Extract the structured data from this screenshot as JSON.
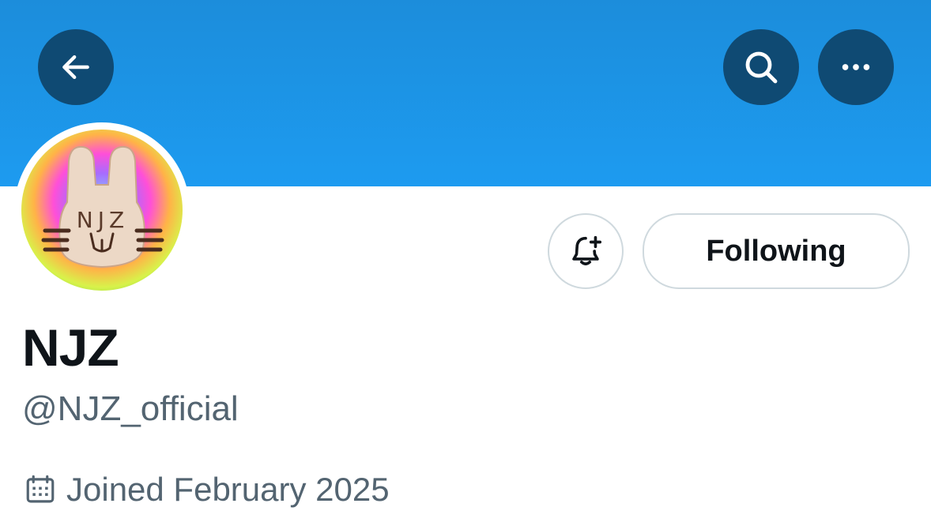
{
  "profile": {
    "display_name": "NJZ",
    "handle": "@NJZ_official",
    "joined": "Joined February 2025",
    "avatar_text": "NJZ"
  },
  "actions": {
    "following_label": "Following"
  },
  "icons": {
    "back": "arrow-left-icon",
    "search": "search-icon",
    "more": "more-horizontal-icon",
    "notify": "bell-plus-icon",
    "calendar": "calendar-icon"
  },
  "colors": {
    "banner": "#1d9bf0",
    "header_button": "#0f4a73",
    "primary_text": "#0f1419",
    "secondary_text": "#536471",
    "border": "#cfd9de"
  }
}
